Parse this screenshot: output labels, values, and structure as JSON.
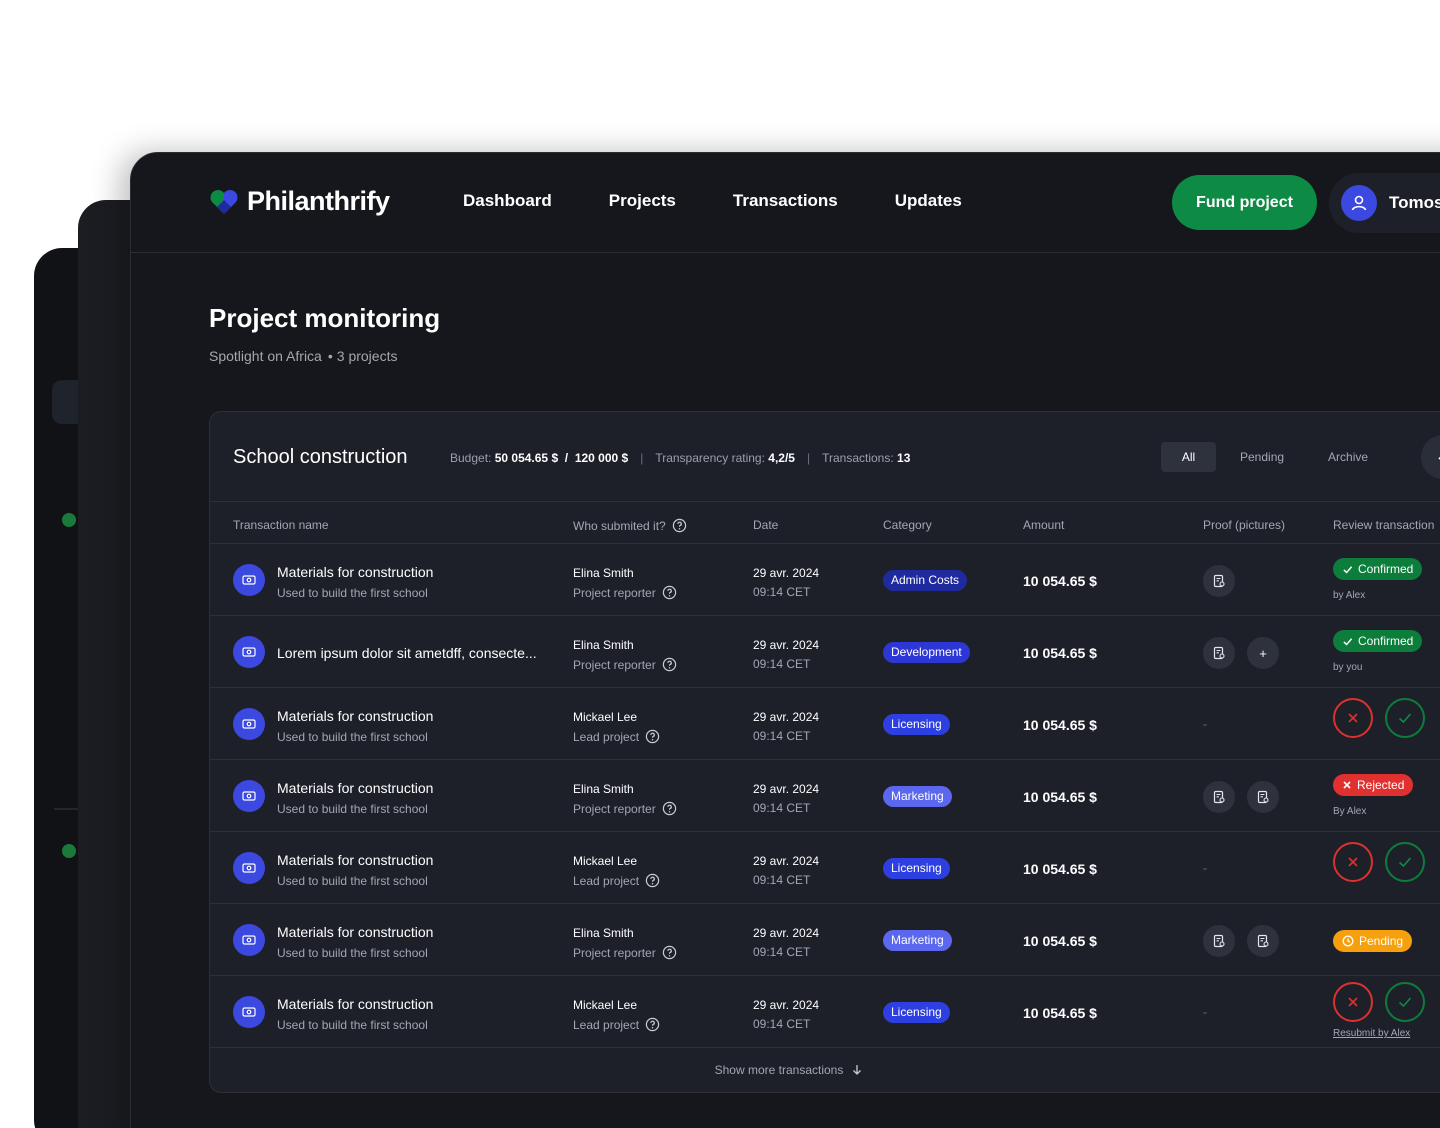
{
  "app": {
    "name": "Philanthrify"
  },
  "nav": {
    "items": [
      "Dashboard",
      "Projects",
      "Transactions",
      "Updates"
    ]
  },
  "header": {
    "fund_button": "Fund project",
    "user_name": "Tomos"
  },
  "page": {
    "title": "Project monitoring",
    "subtitle": "Spotlight on Africa",
    "projects": "3 projects"
  },
  "project": {
    "title": "School construction",
    "budget_label": "Budget:",
    "budget_spent": "50 054.65 $",
    "budget_sep": "/",
    "budget_total": "120 000 $",
    "rating_label": "Transparency rating:",
    "rating_value": "4,2/5",
    "tx_label": "Transactions:",
    "tx_value": "13",
    "filters": [
      "All",
      "Pending",
      "Archive"
    ]
  },
  "table": {
    "columns": [
      "Transaction name",
      "Who submited it?",
      "Date",
      "Category",
      "Amount",
      "Proof (pictures)",
      "Review transaction"
    ],
    "rows": [
      {
        "name": "Materials for construction",
        "desc": "Used to build the first school",
        "who": "Elina Smith",
        "role": "Project reporter",
        "date": "29 avr. 2024",
        "time": "09:14 CET",
        "category": "Admin Costs",
        "amount": "10 054.65 $",
        "proof": "1",
        "status": "Confirmed",
        "by": "by Alex"
      },
      {
        "name": "Lorem ipsum dolor sit ametdff, consecte...",
        "desc": "",
        "who": "Elina Smith",
        "role": "Project reporter",
        "date": "29 avr. 2024",
        "time": "09:14 CET",
        "category": "Development",
        "amount": "10 054.65 $",
        "proof": "1+",
        "status": "Confirmed",
        "by": "by you"
      },
      {
        "name": "Materials for construction",
        "desc": "Used to build the first school",
        "who": "Mickael Lee",
        "role": "Lead project",
        "date": "29 avr. 2024",
        "time": "09:14 CET",
        "category": "Licensing",
        "amount": "10 054.65 $",
        "proof": "-",
        "status": "",
        "by": ""
      },
      {
        "name": "Materials for construction",
        "desc": "Used to build the first school",
        "who": "Elina Smith",
        "role": "Project reporter",
        "date": "29 avr. 2024",
        "time": "09:14 CET",
        "category": "Marketing",
        "amount": "10 054.65 $",
        "proof": "2",
        "status": "Rejected",
        "by": "By Alex"
      },
      {
        "name": "Materials for construction",
        "desc": "Used to build the first school",
        "who": "Mickael Lee",
        "role": "Lead project",
        "date": "29 avr. 2024",
        "time": "09:14 CET",
        "category": "Licensing",
        "amount": "10 054.65 $",
        "proof": "-",
        "status": "",
        "by": ""
      },
      {
        "name": "Materials for construction",
        "desc": "Used to build the first school",
        "who": "Elina Smith",
        "role": "Project reporter",
        "date": "29 avr. 2024",
        "time": "09:14 CET",
        "category": "Marketing",
        "amount": "10 054.65 $",
        "proof": "2",
        "status": "Pending",
        "by": ""
      },
      {
        "name": "Materials for construction",
        "desc": "Used to build the first school",
        "who": "Mickael Lee",
        "role": "Lead project",
        "date": "29 avr. 2024",
        "time": "09:14 CET",
        "category": "Licensing",
        "amount": "10 054.65 $",
        "proof": "-",
        "status": "",
        "by": "Resubmit by Alex"
      }
    ],
    "show_more": "Show more transactions"
  },
  "colors": {
    "accent": "#3b49e0",
    "success": "#0d7d3b",
    "danger": "#e0302f",
    "warning": "#f5a00c",
    "category": {
      "Admin Costs": "#1e2a9e",
      "Development": "#2d37d6",
      "Licensing": "#2d3fe0",
      "Marketing": "#5a67ee"
    }
  },
  "icons": {
    "logo": "heart-logo-icon",
    "user": "user-icon",
    "help": "help-circle-icon",
    "receipt": "receipt-icon",
    "photo": "money-icon",
    "add": "plus-icon",
    "reject": "close-icon",
    "approve": "check-icon",
    "pending": "clock-icon",
    "down": "arrow-down-icon",
    "collapse": "chevron-up-icon"
  }
}
